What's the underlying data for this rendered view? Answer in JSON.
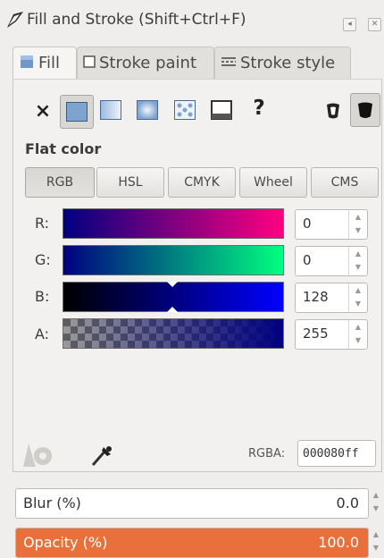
{
  "window": {
    "title": "Fill and Stroke (Shift+Ctrl+F)",
    "buttons": [
      "iconify-icon",
      "close-icon"
    ]
  },
  "tabs": [
    {
      "label": "Fill",
      "icon": "fill-swatch-icon",
      "active": true
    },
    {
      "label": "Stroke paint",
      "icon": "stroke-swatch-icon",
      "active": false
    },
    {
      "label": "Stroke style",
      "icon": "stroke-style-icon",
      "active": false
    }
  ],
  "paint_types": [
    {
      "name": "no-paint",
      "symbol": "×"
    },
    {
      "name": "flat-color",
      "selected": true
    },
    {
      "name": "linear-gradient"
    },
    {
      "name": "radial-gradient"
    },
    {
      "name": "pattern"
    },
    {
      "name": "swatch"
    },
    {
      "name": "unset",
      "symbol": "?"
    }
  ],
  "fill_rule": [
    "evenodd-icon",
    "nonzero-icon"
  ],
  "section_title": "Flat color",
  "modes": [
    "RGB",
    "HSL",
    "CMYK",
    "Wheel",
    "CMS"
  ],
  "active_mode": "RGB",
  "channels": [
    {
      "label": "R:",
      "value": "0"
    },
    {
      "label": "G:",
      "value": "0"
    },
    {
      "label": "B:",
      "value": "128"
    },
    {
      "label": "A:",
      "value": "255"
    }
  ],
  "rgba": {
    "label": "RGBA:",
    "value": "000080ff"
  },
  "blur": {
    "label": "Blur (%)",
    "value": "0.0"
  },
  "opacity": {
    "label": "Opacity (%)",
    "value": "100.0",
    "fill_color": "#e9703a"
  },
  "colors": {
    "current": "#000080",
    "accent": "#e9703a"
  }
}
